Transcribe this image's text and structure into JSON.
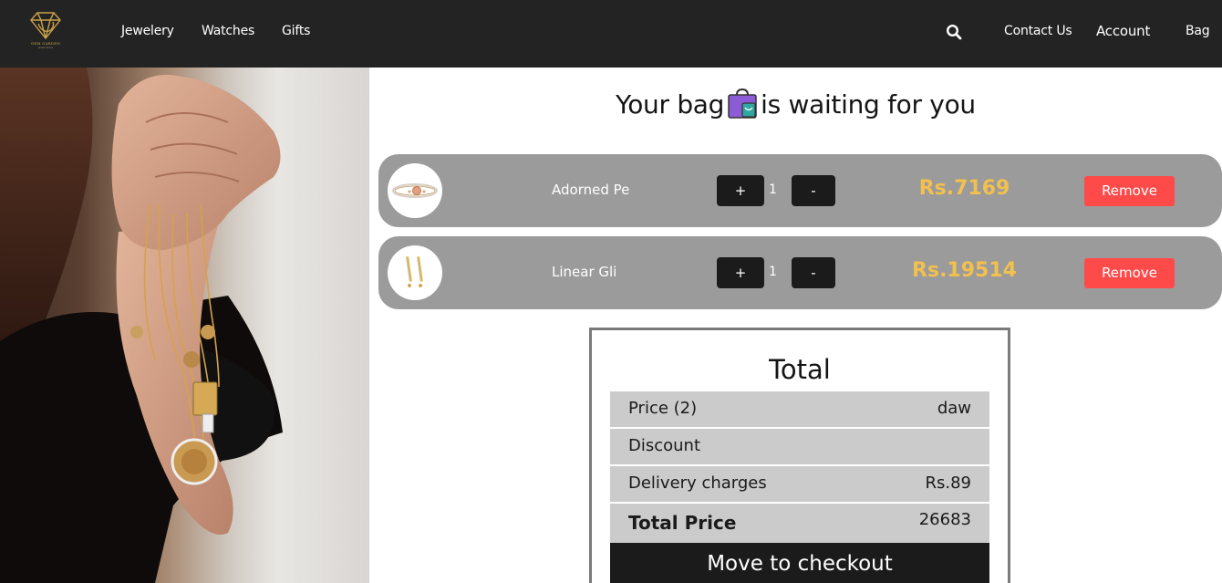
{
  "brand": {
    "logo_text": "GEM GARDEN",
    "logo_subtext": "jewel store"
  },
  "nav": {
    "links": [
      "Jewelery",
      "Watches",
      "Gifts"
    ],
    "contact": "Contact Us",
    "account": "Account",
    "bag": "Bag"
  },
  "icons": {
    "search": "search-icon",
    "bag": "shopping-bag-icon"
  },
  "cart": {
    "title_before": "Your bag",
    "title_after": "is waiting for you",
    "items": [
      {
        "name": "Adorned Pe",
        "quantity": "1",
        "price": "Rs.7169",
        "plus": "+",
        "minus": "-",
        "remove": "Remove"
      },
      {
        "name": "Linear Gli",
        "quantity": "1",
        "price": "Rs.19514",
        "plus": "+",
        "minus": "-",
        "remove": "Remove"
      }
    ]
  },
  "summary": {
    "title": "Total",
    "rows": [
      {
        "label": "Price (2)",
        "value": "daw"
      },
      {
        "label": "Discount",
        "value": ""
      },
      {
        "label": "Delivery charges",
        "value": "Rs.89"
      }
    ],
    "total_label": "Total Price",
    "total_value": "26683",
    "checkout": "Move to checkout"
  },
  "colors": {
    "navbar": "#232323",
    "row_bg": "#9b9b9b",
    "price": "#f2c04e",
    "remove": "#ff4a4a",
    "summary_row": "#cbcbcb",
    "checkout": "#1b1b1b"
  }
}
